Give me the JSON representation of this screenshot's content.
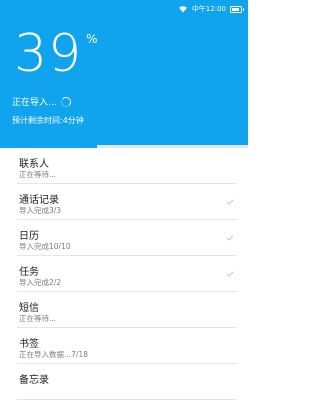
{
  "status": {
    "time": "中午12:00"
  },
  "progress": {
    "percent_value": "39",
    "percent_sign": "%",
    "fraction": 0.39
  },
  "importing_text": "正在导入...",
  "eta_text": "预计剩余时间:4分钟",
  "items": [
    {
      "title": "联系人",
      "subtitle": "正在等待...",
      "done": false
    },
    {
      "title": "通话记录",
      "subtitle": "导入完成3/3",
      "done": true
    },
    {
      "title": "日历",
      "subtitle": "导入完成10/10",
      "done": true
    },
    {
      "title": "任务",
      "subtitle": "导入完成2/2",
      "done": true
    },
    {
      "title": "短信",
      "subtitle": "正在等待...",
      "done": false
    },
    {
      "title": "书签",
      "subtitle": "正在导入数据...7/18",
      "done": false
    },
    {
      "title": "备忘录",
      "subtitle": "",
      "done": false
    }
  ],
  "colors": {
    "accent": "#10A3EE",
    "check": "#bdbdbd"
  }
}
